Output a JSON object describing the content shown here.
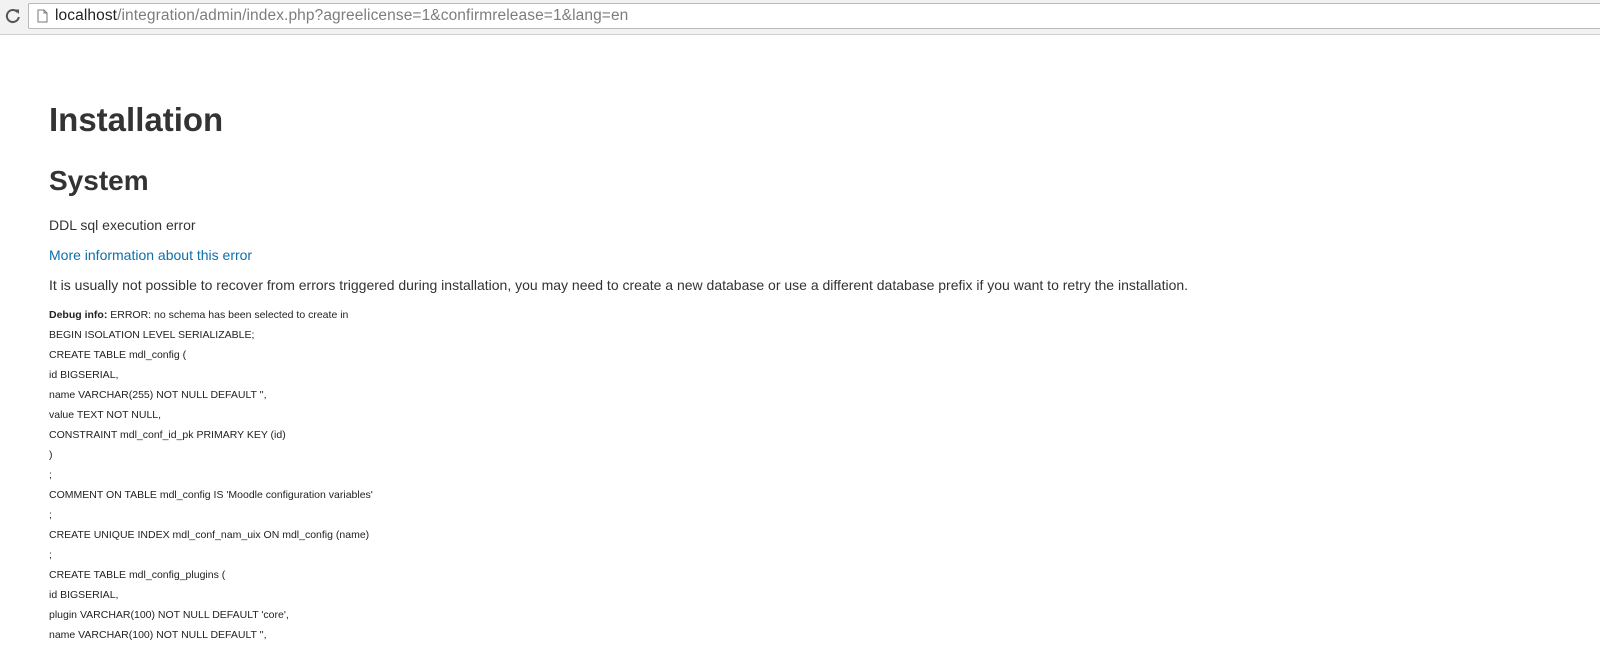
{
  "browser": {
    "url_host": "localhost",
    "url_rest": "/integration/admin/index.php?agreelicense=1&confirmrelease=1&lang=en",
    "reload_icon": "reload-icon",
    "page_icon": "page-icon"
  },
  "page": {
    "heading": "Installation",
    "subheading": "System",
    "error_message": "DDL sql execution error",
    "more_info_link": "More information about this error",
    "recovery_note": "It is usually not possible to recover from errors triggered during installation, you may need to create a new database or use a different database prefix if you want to retry the installation.",
    "debug_label": "Debug info:",
    "debug_first": " ERROR: no schema has been selected to create in",
    "debug_lines": [
      "BEGIN ISOLATION LEVEL SERIALIZABLE;",
      "CREATE TABLE mdl_config (",
      "id BIGSERIAL,",
      "name VARCHAR(255) NOT NULL DEFAULT '',",
      "value TEXT NOT NULL,",
      "CONSTRAINT mdl_conf_id_pk PRIMARY KEY (id)",
      ")",
      ";",
      "COMMENT ON TABLE mdl_config IS 'Moodle configuration variables'",
      ";",
      "CREATE UNIQUE INDEX mdl_conf_nam_uix ON mdl_config (name)",
      ";",
      "CREATE TABLE mdl_config_plugins (",
      "id BIGSERIAL,",
      "plugin VARCHAR(100) NOT NULL DEFAULT 'core',",
      "name VARCHAR(100) NOT NULL DEFAULT '',"
    ]
  },
  "colors": {
    "link": "#0f6fa8",
    "text": "#333333",
    "toolbar": "#f2f2f2"
  }
}
